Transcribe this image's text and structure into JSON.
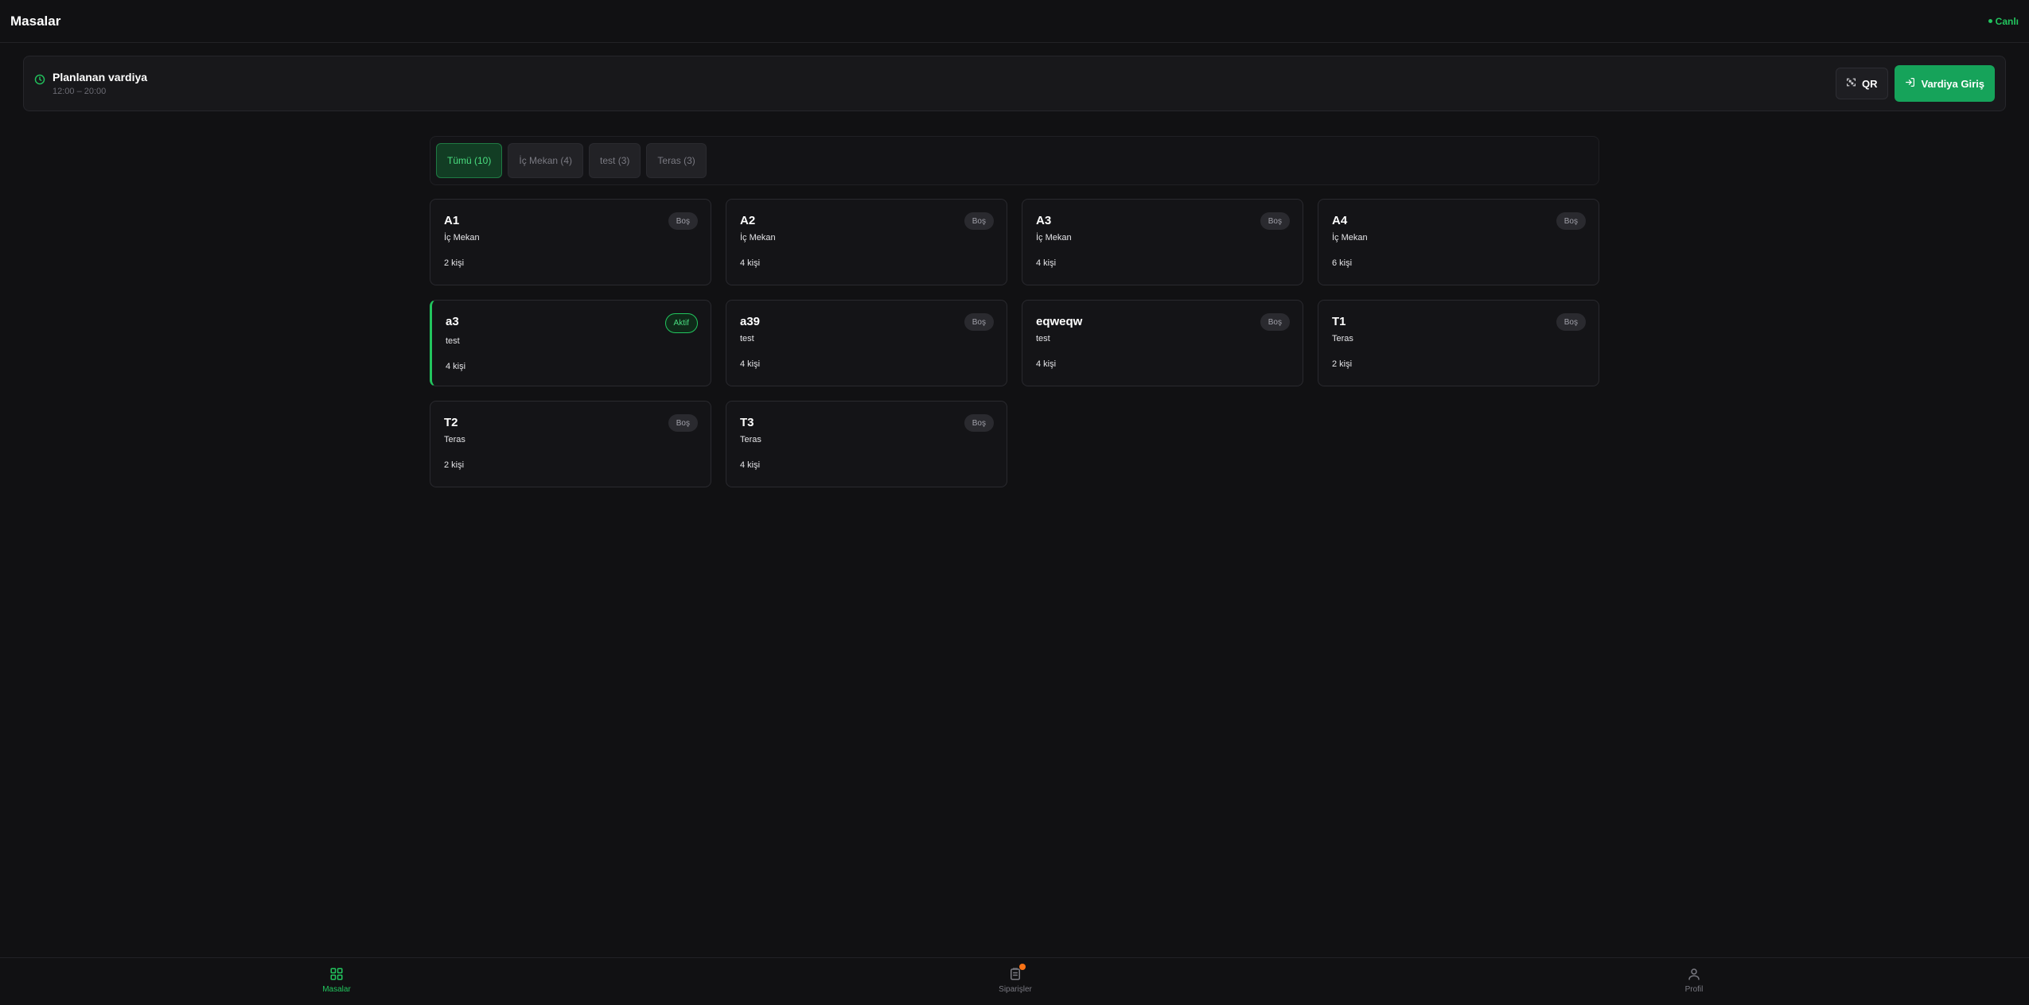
{
  "header": {
    "title": "Masalar",
    "live_label": "Canlı"
  },
  "shift": {
    "title": "Planlanan vardiya",
    "time": "12:00 – 20:00",
    "qr_label": "QR",
    "enter_label": "Vardiya Giriş"
  },
  "filters": [
    {
      "label": "Tümü (10)",
      "active": true
    },
    {
      "label": "İç Mekan (4)",
      "active": false
    },
    {
      "label": "test (3)",
      "active": false
    },
    {
      "label": "Teras (3)",
      "active": false
    }
  ],
  "tables": [
    {
      "name": "A1",
      "zone": "İç Mekan",
      "capacity": "2 kişi",
      "status": "Boş"
    },
    {
      "name": "A2",
      "zone": "İç Mekan",
      "capacity": "4 kişi",
      "status": "Boş"
    },
    {
      "name": "A3",
      "zone": "İç Mekan",
      "capacity": "4 kişi",
      "status": "Boş"
    },
    {
      "name": "A4",
      "zone": "İç Mekan",
      "capacity": "6 kişi",
      "status": "Boş"
    },
    {
      "name": "a3",
      "zone": "test",
      "capacity": "4 kişi",
      "status": "Aktif"
    },
    {
      "name": "a39",
      "zone": "test",
      "capacity": "4 kişi",
      "status": "Boş"
    },
    {
      "name": "eqweqw",
      "zone": "test",
      "capacity": "4 kişi",
      "status": "Boş"
    },
    {
      "name": "T1",
      "zone": "Teras",
      "capacity": "2 kişi",
      "status": "Boş"
    },
    {
      "name": "T2",
      "zone": "Teras",
      "capacity": "2 kişi",
      "status": "Boş"
    },
    {
      "name": "T3",
      "zone": "Teras",
      "capacity": "4 kişi",
      "status": "Boş"
    }
  ],
  "nav": {
    "tables": "Masalar",
    "orders": "Siparişler",
    "profile": "Profil"
  },
  "colors": {
    "accent": "#22c55e",
    "button_green": "#16a35a",
    "notification": "#f97316",
    "background": "#111113"
  }
}
